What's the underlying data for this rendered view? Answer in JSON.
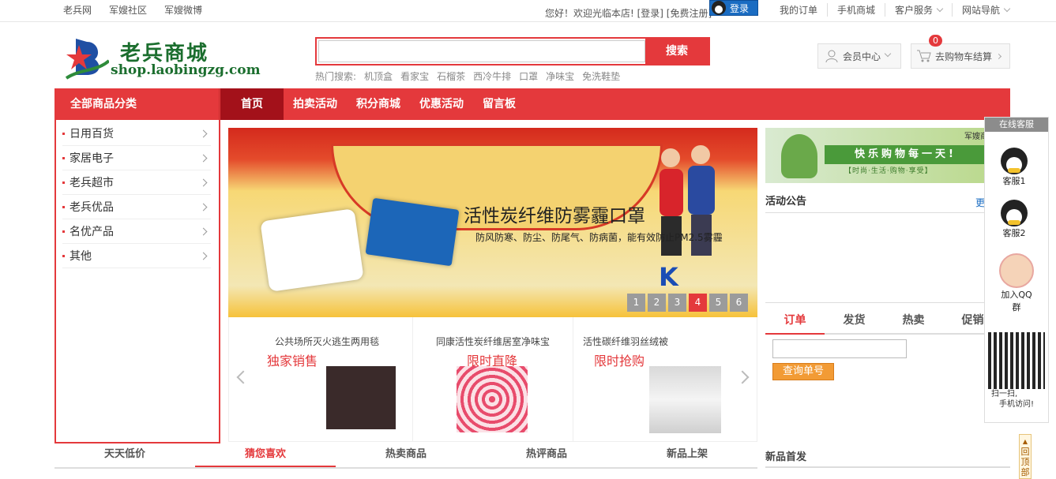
{
  "topbar": {
    "links": [
      "老兵网",
      "军嫂社区",
      "军嫂微博"
    ],
    "welcome": "您好！欢迎光临本店! [登录] [免费注册]",
    "qq_login": "登录",
    "right_links": [
      "我的订单",
      "手机商城",
      "客户服务",
      "网站导航"
    ]
  },
  "logo": {
    "name": "老兵商城",
    "url": "shop.laobingzg.com"
  },
  "search": {
    "placeholder": "",
    "button": "搜索"
  },
  "hot_search": {
    "label": "热门搜索:",
    "terms": [
      "机顶盒",
      "看家宝",
      "石榴茶",
      "西冷牛排",
      "口罩",
      "净味宝",
      "免洗鞋垫"
    ]
  },
  "member": {
    "label": "会员中心"
  },
  "cart": {
    "label": "去购物车结算",
    "count": "0"
  },
  "nav": {
    "category": "全部商品分类",
    "items": [
      "首页",
      "拍卖活动",
      "积分商城",
      "优惠活动",
      "留言板"
    ]
  },
  "sidebar": {
    "items": [
      "日用百货",
      "家居电子",
      "老兵超市",
      "老兵优品",
      "名优产品",
      "其他"
    ]
  },
  "banner": {
    "title": "活性炭纤维防雾霾口罩",
    "subtitle": "防风防寒、防尘、防尾气、防病菌，能有效防止PM2.5雾霾",
    "slides": [
      "1",
      "2",
      "3",
      "4",
      "5",
      "6"
    ],
    "active_slide": "4"
  },
  "promos": [
    {
      "title": "公共场所灭火逃生两用毯",
      "tag": "独家销售"
    },
    {
      "title": "同康活性炭纤维居室净味宝",
      "tag": "限时直降"
    },
    {
      "title": "活性碳纤维羽丝绒被",
      "tag": "限时抢购"
    }
  ],
  "ad_banner": {
    "slogan": "快乐购物每一天!",
    "sub": "【时尚·生活·购物·享受】",
    "tag": "军嫂商城"
  },
  "notice": {
    "title": "活动公告",
    "more": "更多"
  },
  "orders": {
    "tabs": [
      "订单",
      "发货",
      "热卖",
      "促销"
    ],
    "query_button": "查询单号"
  },
  "service": {
    "title": "在线客服",
    "agents": [
      "客服1",
      "客服2"
    ],
    "group": "加入QQ群",
    "qr_caption_1": "扫一扫,",
    "qr_caption_2": "手机访问!"
  },
  "to_top": "回顶部",
  "bottom_tabs": [
    "天天低价",
    "猜您喜欢",
    "热卖商品",
    "热评商品",
    "新品上架"
  ],
  "new_first": "新品首发",
  "colors": {
    "accent": "#e4393c",
    "dark_red": "#a3111a",
    "brand_green": "#1b6e2e"
  }
}
